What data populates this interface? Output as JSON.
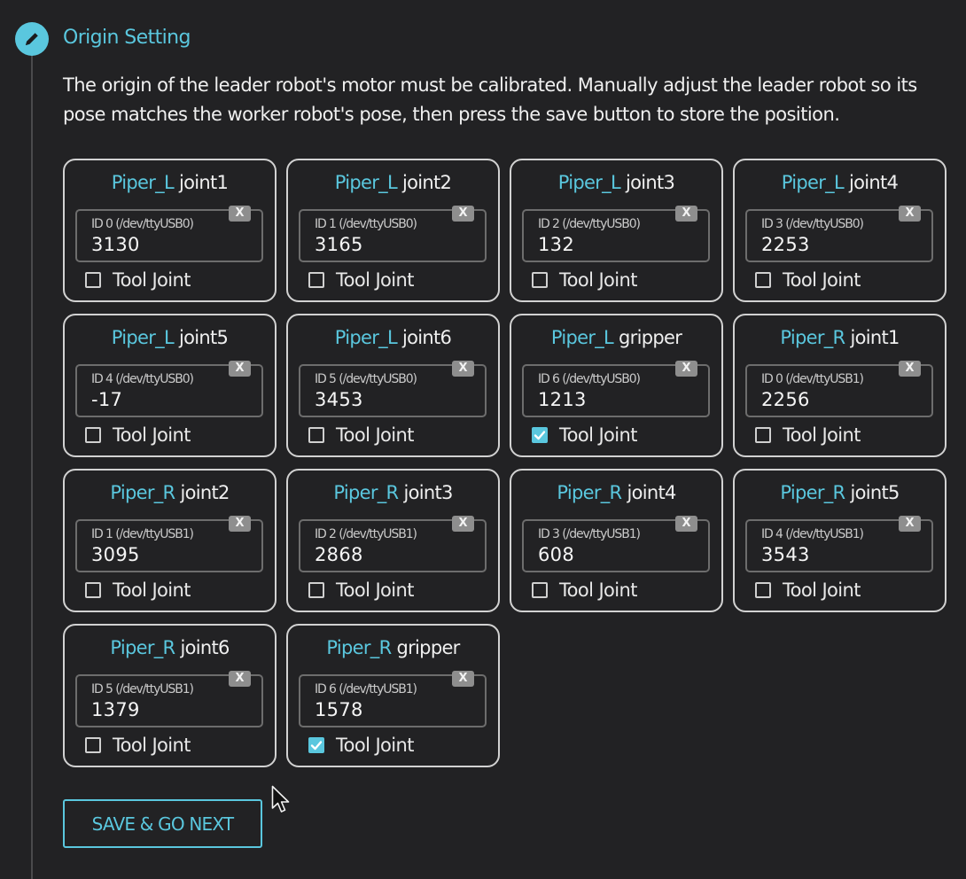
{
  "section": {
    "title": "Origin Setting",
    "description": "The origin of the leader robot's motor must be calibrated. Manually adjust the leader robot so its pose matches the worker robot's pose, then press the save button to store the position."
  },
  "colors": {
    "accent": "#5ac7de",
    "background": "#222224",
    "card_border": "#d2d2d2"
  },
  "icons": {
    "step": "pencil-icon",
    "clear": "clear-x-icon",
    "cursor": "mouse-cursor-icon"
  },
  "joints": [
    {
      "robot": "Piper_L",
      "joint": "joint1",
      "id_label": "ID 0 (/dev/ttyUSB0)",
      "value": "3130",
      "clear": "X",
      "tool_label": "Tool Joint",
      "tool_joint": false
    },
    {
      "robot": "Piper_L",
      "joint": "joint2",
      "id_label": "ID 1 (/dev/ttyUSB0)",
      "value": "3165",
      "clear": "X",
      "tool_label": "Tool Joint",
      "tool_joint": false
    },
    {
      "robot": "Piper_L",
      "joint": "joint3",
      "id_label": "ID 2 (/dev/ttyUSB0)",
      "value": "132",
      "clear": "X",
      "tool_label": "Tool Joint",
      "tool_joint": false
    },
    {
      "robot": "Piper_L",
      "joint": "joint4",
      "id_label": "ID 3 (/dev/ttyUSB0)",
      "value": "2253",
      "clear": "X",
      "tool_label": "Tool Joint",
      "tool_joint": false
    },
    {
      "robot": "Piper_L",
      "joint": "joint5",
      "id_label": "ID 4 (/dev/ttyUSB0)",
      "value": "-17",
      "clear": "X",
      "tool_label": "Tool Joint",
      "tool_joint": false
    },
    {
      "robot": "Piper_L",
      "joint": "joint6",
      "id_label": "ID 5 (/dev/ttyUSB0)",
      "value": "3453",
      "clear": "X",
      "tool_label": "Tool Joint",
      "tool_joint": false
    },
    {
      "robot": "Piper_L",
      "joint": "gripper",
      "id_label": "ID 6 (/dev/ttyUSB0)",
      "value": "1213",
      "clear": "X",
      "tool_label": "Tool Joint",
      "tool_joint": true
    },
    {
      "robot": "Piper_R",
      "joint": "joint1",
      "id_label": "ID 0 (/dev/ttyUSB1)",
      "value": "2256",
      "clear": "X",
      "tool_label": "Tool Joint",
      "tool_joint": false
    },
    {
      "robot": "Piper_R",
      "joint": "joint2",
      "id_label": "ID 1 (/dev/ttyUSB1)",
      "value": "3095",
      "clear": "X",
      "tool_label": "Tool Joint",
      "tool_joint": false
    },
    {
      "robot": "Piper_R",
      "joint": "joint3",
      "id_label": "ID 2 (/dev/ttyUSB1)",
      "value": "2868",
      "clear": "X",
      "tool_label": "Tool Joint",
      "tool_joint": false
    },
    {
      "robot": "Piper_R",
      "joint": "joint4",
      "id_label": "ID 3 (/dev/ttyUSB1)",
      "value": "608",
      "clear": "X",
      "tool_label": "Tool Joint",
      "tool_joint": false
    },
    {
      "robot": "Piper_R",
      "joint": "joint5",
      "id_label": "ID 4 (/dev/ttyUSB1)",
      "value": "3543",
      "clear": "X",
      "tool_label": "Tool Joint",
      "tool_joint": false
    },
    {
      "robot": "Piper_R",
      "joint": "joint6",
      "id_label": "ID 5 (/dev/ttyUSB1)",
      "value": "1379",
      "clear": "X",
      "tool_label": "Tool Joint",
      "tool_joint": false
    },
    {
      "robot": "Piper_R",
      "joint": "gripper",
      "id_label": "ID 6 (/dev/ttyUSB1)",
      "value": "1578",
      "clear": "X",
      "tool_label": "Tool Joint",
      "tool_joint": true
    }
  ],
  "actions": {
    "save_label": "SAVE & GO NEXT"
  }
}
